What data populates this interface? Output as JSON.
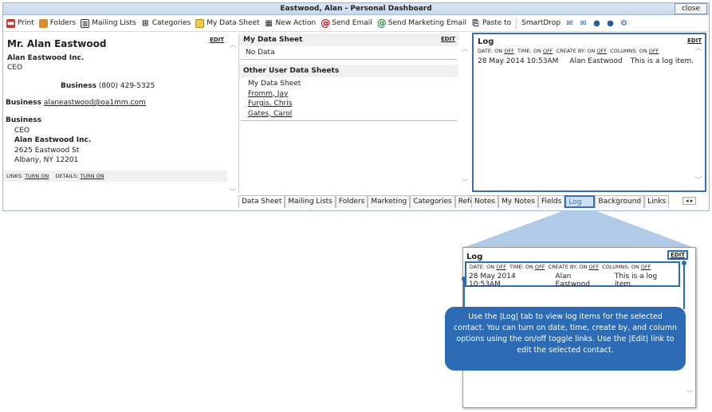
{
  "window": {
    "title": "Eastwood, Alan - Personal Dashboard",
    "close_label": "close"
  },
  "toolbar": {
    "items": [
      {
        "label": "Print",
        "icon": "printer-icon"
      },
      {
        "label": "Folders",
        "icon": "folder-icon"
      },
      {
        "label": "Mailing Lists",
        "icon": "mailing-list-icon"
      },
      {
        "label": "Categories",
        "icon": "categories-icon"
      },
      {
        "label": "My Data Sheet",
        "icon": "data-sheet-icon"
      },
      {
        "label": "New Action",
        "icon": "calendar-icon"
      },
      {
        "label": "Send Email",
        "icon": "at-red-icon"
      },
      {
        "label": "Send Marketing Email",
        "icon": "at-green-icon"
      },
      {
        "label": "Paste to",
        "icon": "paste-icon"
      }
    ],
    "smartdrop_label": "SmartDrop"
  },
  "contact": {
    "edit": "EDIT",
    "name": "Mr. Alan Eastwood",
    "company": "Alan Eastwood Inc.",
    "title": "CEO",
    "phone_label": "Business",
    "phone": "(800) 429-5325",
    "email_label": "Business",
    "email": "alaneastwood@oa1mm.com",
    "address_label": "Business",
    "address_lines": [
      "CEO",
      "Alan Eastwood Inc.",
      "2625 Eastwood St",
      "Albany, NY 12201"
    ],
    "links_label": "LINKS:",
    "links_toggle": "TURN ON",
    "details_label": "DETAILS:",
    "details_toggle": "TURN ON"
  },
  "datasheet": {
    "title": "My Data Sheet",
    "edit": "EDIT",
    "empty": "No Data",
    "other_title": "Other User Data Sheets",
    "other_items": [
      "My Data Sheet",
      "Fromm, Jay",
      "Furgis, Chris",
      "Gates, Carol"
    ]
  },
  "log": {
    "title": "Log",
    "edit": "EDIT",
    "options": [
      {
        "label": "DATE: ON",
        "value": "OFF"
      },
      {
        "label": "TIME: ON",
        "value": "OFF"
      },
      {
        "label": "CREATE BY: ON",
        "value": "OFF"
      },
      {
        "label": "COLUMNS: ON",
        "value": "OFF"
      }
    ],
    "entry": {
      "datetime": "28 May 2014 10:53AM",
      "user": "Alan Eastwood",
      "text": "This is a log item."
    }
  },
  "tabs_middle": [
    "Data Sheet",
    "Mailing Lists",
    "Folders",
    "Marketing",
    "Categories",
    "Referrals"
  ],
  "tabs_right": [
    "Notes",
    "My Notes",
    "Fields",
    "Log",
    "Background",
    "Links"
  ],
  "callout_text": "Use the |Log| tab to view log items for the selected contact.  You can turn on date, time, create by, and column options using the  on/off toggle links.  Use the |Edit| link to edit the selected contact.",
  "colors": {
    "accent": "#3a6fb4",
    "bubble": "#2d6bb5",
    "funnel": "#a9c4e4"
  }
}
